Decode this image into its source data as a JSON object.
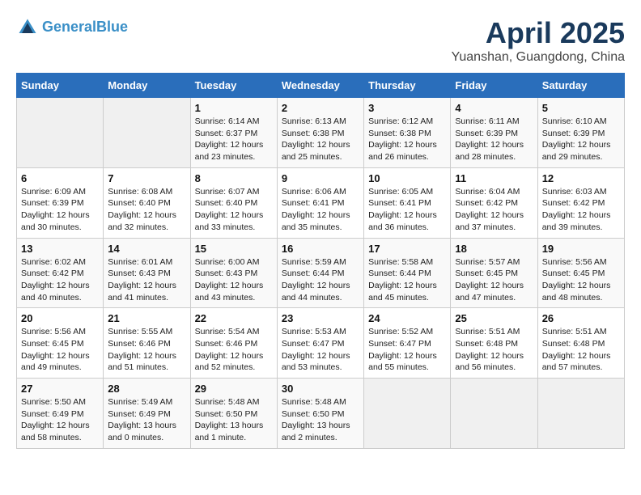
{
  "header": {
    "logo_line1": "General",
    "logo_line2": "Blue",
    "month": "April 2025",
    "location": "Yuanshan, Guangdong, China"
  },
  "days_of_week": [
    "Sunday",
    "Monday",
    "Tuesday",
    "Wednesday",
    "Thursday",
    "Friday",
    "Saturday"
  ],
  "weeks": [
    [
      {
        "day": "",
        "sunrise": "",
        "sunset": "",
        "daylight": "",
        "empty": true
      },
      {
        "day": "",
        "sunrise": "",
        "sunset": "",
        "daylight": "",
        "empty": true
      },
      {
        "day": "1",
        "sunrise": "Sunrise: 6:14 AM",
        "sunset": "Sunset: 6:37 PM",
        "daylight": "Daylight: 12 hours and 23 minutes."
      },
      {
        "day": "2",
        "sunrise": "Sunrise: 6:13 AM",
        "sunset": "Sunset: 6:38 PM",
        "daylight": "Daylight: 12 hours and 25 minutes."
      },
      {
        "day": "3",
        "sunrise": "Sunrise: 6:12 AM",
        "sunset": "Sunset: 6:38 PM",
        "daylight": "Daylight: 12 hours and 26 minutes."
      },
      {
        "day": "4",
        "sunrise": "Sunrise: 6:11 AM",
        "sunset": "Sunset: 6:39 PM",
        "daylight": "Daylight: 12 hours and 28 minutes."
      },
      {
        "day": "5",
        "sunrise": "Sunrise: 6:10 AM",
        "sunset": "Sunset: 6:39 PM",
        "daylight": "Daylight: 12 hours and 29 minutes."
      }
    ],
    [
      {
        "day": "6",
        "sunrise": "Sunrise: 6:09 AM",
        "sunset": "Sunset: 6:39 PM",
        "daylight": "Daylight: 12 hours and 30 minutes."
      },
      {
        "day": "7",
        "sunrise": "Sunrise: 6:08 AM",
        "sunset": "Sunset: 6:40 PM",
        "daylight": "Daylight: 12 hours and 32 minutes."
      },
      {
        "day": "8",
        "sunrise": "Sunrise: 6:07 AM",
        "sunset": "Sunset: 6:40 PM",
        "daylight": "Daylight: 12 hours and 33 minutes."
      },
      {
        "day": "9",
        "sunrise": "Sunrise: 6:06 AM",
        "sunset": "Sunset: 6:41 PM",
        "daylight": "Daylight: 12 hours and 35 minutes."
      },
      {
        "day": "10",
        "sunrise": "Sunrise: 6:05 AM",
        "sunset": "Sunset: 6:41 PM",
        "daylight": "Daylight: 12 hours and 36 minutes."
      },
      {
        "day": "11",
        "sunrise": "Sunrise: 6:04 AM",
        "sunset": "Sunset: 6:42 PM",
        "daylight": "Daylight: 12 hours and 37 minutes."
      },
      {
        "day": "12",
        "sunrise": "Sunrise: 6:03 AM",
        "sunset": "Sunset: 6:42 PM",
        "daylight": "Daylight: 12 hours and 39 minutes."
      }
    ],
    [
      {
        "day": "13",
        "sunrise": "Sunrise: 6:02 AM",
        "sunset": "Sunset: 6:42 PM",
        "daylight": "Daylight: 12 hours and 40 minutes."
      },
      {
        "day": "14",
        "sunrise": "Sunrise: 6:01 AM",
        "sunset": "Sunset: 6:43 PM",
        "daylight": "Daylight: 12 hours and 41 minutes."
      },
      {
        "day": "15",
        "sunrise": "Sunrise: 6:00 AM",
        "sunset": "Sunset: 6:43 PM",
        "daylight": "Daylight: 12 hours and 43 minutes."
      },
      {
        "day": "16",
        "sunrise": "Sunrise: 5:59 AM",
        "sunset": "Sunset: 6:44 PM",
        "daylight": "Daylight: 12 hours and 44 minutes."
      },
      {
        "day": "17",
        "sunrise": "Sunrise: 5:58 AM",
        "sunset": "Sunset: 6:44 PM",
        "daylight": "Daylight: 12 hours and 45 minutes."
      },
      {
        "day": "18",
        "sunrise": "Sunrise: 5:57 AM",
        "sunset": "Sunset: 6:45 PM",
        "daylight": "Daylight: 12 hours and 47 minutes."
      },
      {
        "day": "19",
        "sunrise": "Sunrise: 5:56 AM",
        "sunset": "Sunset: 6:45 PM",
        "daylight": "Daylight: 12 hours and 48 minutes."
      }
    ],
    [
      {
        "day": "20",
        "sunrise": "Sunrise: 5:56 AM",
        "sunset": "Sunset: 6:45 PM",
        "daylight": "Daylight: 12 hours and 49 minutes."
      },
      {
        "day": "21",
        "sunrise": "Sunrise: 5:55 AM",
        "sunset": "Sunset: 6:46 PM",
        "daylight": "Daylight: 12 hours and 51 minutes."
      },
      {
        "day": "22",
        "sunrise": "Sunrise: 5:54 AM",
        "sunset": "Sunset: 6:46 PM",
        "daylight": "Daylight: 12 hours and 52 minutes."
      },
      {
        "day": "23",
        "sunrise": "Sunrise: 5:53 AM",
        "sunset": "Sunset: 6:47 PM",
        "daylight": "Daylight: 12 hours and 53 minutes."
      },
      {
        "day": "24",
        "sunrise": "Sunrise: 5:52 AM",
        "sunset": "Sunset: 6:47 PM",
        "daylight": "Daylight: 12 hours and 55 minutes."
      },
      {
        "day": "25",
        "sunrise": "Sunrise: 5:51 AM",
        "sunset": "Sunset: 6:48 PM",
        "daylight": "Daylight: 12 hours and 56 minutes."
      },
      {
        "day": "26",
        "sunrise": "Sunrise: 5:51 AM",
        "sunset": "Sunset: 6:48 PM",
        "daylight": "Daylight: 12 hours and 57 minutes."
      }
    ],
    [
      {
        "day": "27",
        "sunrise": "Sunrise: 5:50 AM",
        "sunset": "Sunset: 6:49 PM",
        "daylight": "Daylight: 12 hours and 58 minutes."
      },
      {
        "day": "28",
        "sunrise": "Sunrise: 5:49 AM",
        "sunset": "Sunset: 6:49 PM",
        "daylight": "Daylight: 13 hours and 0 minutes."
      },
      {
        "day": "29",
        "sunrise": "Sunrise: 5:48 AM",
        "sunset": "Sunset: 6:50 PM",
        "daylight": "Daylight: 13 hours and 1 minute."
      },
      {
        "day": "30",
        "sunrise": "Sunrise: 5:48 AM",
        "sunset": "Sunset: 6:50 PM",
        "daylight": "Daylight: 13 hours and 2 minutes."
      },
      {
        "day": "",
        "sunrise": "",
        "sunset": "",
        "daylight": "",
        "empty": true
      },
      {
        "day": "",
        "sunrise": "",
        "sunset": "",
        "daylight": "",
        "empty": true
      },
      {
        "day": "",
        "sunrise": "",
        "sunset": "",
        "daylight": "",
        "empty": true
      }
    ]
  ]
}
